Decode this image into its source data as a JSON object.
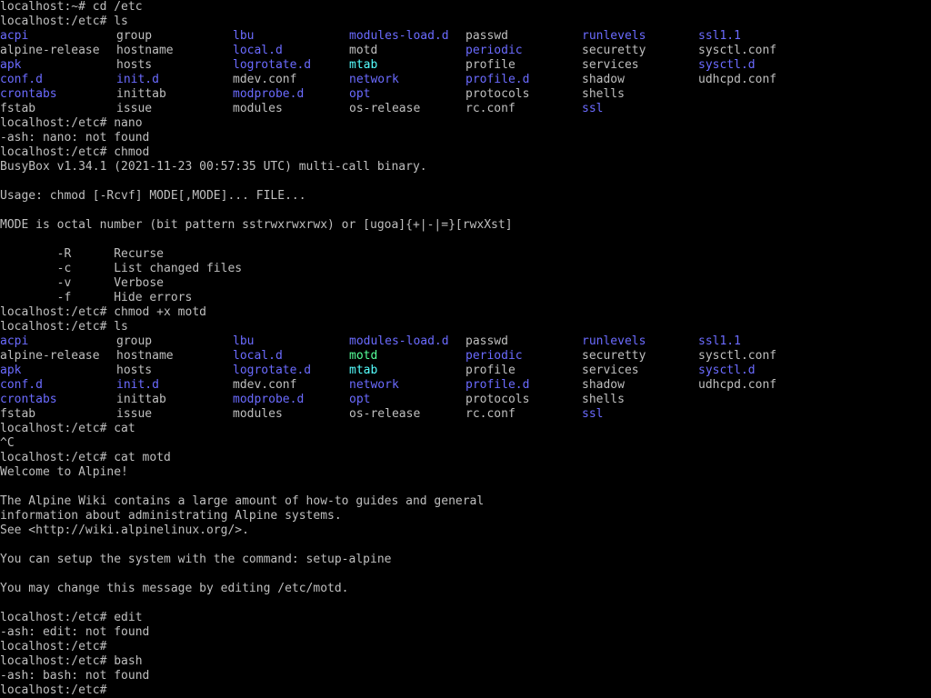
{
  "colors": {
    "background": "#000000",
    "text": "#bfbfbf",
    "directory": "#6b6bff",
    "executable": "#55ff99",
    "symlink": "#55ffff"
  },
  "terminal": {
    "blocks": [
      {
        "type": "text",
        "text": "localhost:~# cd /etc"
      },
      {
        "type": "text",
        "text": "localhost:/etc# ls"
      },
      {
        "type": "ls",
        "rows": [
          [
            {
              "t": "acpi",
              "k": "dir"
            },
            {
              "t": "group",
              "k": "file"
            },
            {
              "t": "lbu",
              "k": "dir"
            },
            {
              "t": "modules-load.d",
              "k": "dir"
            },
            {
              "t": "passwd",
              "k": "file"
            },
            {
              "t": "runlevels",
              "k": "dir"
            },
            {
              "t": "ssl1.1",
              "k": "dir"
            }
          ],
          [
            {
              "t": "alpine-release",
              "k": "file"
            },
            {
              "t": "hostname",
              "k": "file"
            },
            {
              "t": "local.d",
              "k": "dir"
            },
            {
              "t": "motd",
              "k": "file"
            },
            {
              "t": "periodic",
              "k": "dir"
            },
            {
              "t": "securetty",
              "k": "file"
            },
            {
              "t": "sysctl.conf",
              "k": "file"
            }
          ],
          [
            {
              "t": "apk",
              "k": "dir"
            },
            {
              "t": "hosts",
              "k": "file"
            },
            {
              "t": "logrotate.d",
              "k": "dir"
            },
            {
              "t": "mtab",
              "k": "link"
            },
            {
              "t": "profile",
              "k": "file"
            },
            {
              "t": "services",
              "k": "file"
            },
            {
              "t": "sysctl.d",
              "k": "dir"
            }
          ],
          [
            {
              "t": "conf.d",
              "k": "dir"
            },
            {
              "t": "init.d",
              "k": "dir"
            },
            {
              "t": "mdev.conf",
              "k": "file"
            },
            {
              "t": "network",
              "k": "dir"
            },
            {
              "t": "profile.d",
              "k": "dir"
            },
            {
              "t": "shadow",
              "k": "file"
            },
            {
              "t": "udhcpd.conf",
              "k": "file"
            }
          ],
          [
            {
              "t": "crontabs",
              "k": "dir"
            },
            {
              "t": "inittab",
              "k": "file"
            },
            {
              "t": "modprobe.d",
              "k": "dir"
            },
            {
              "t": "opt",
              "k": "dir"
            },
            {
              "t": "protocols",
              "k": "file"
            },
            {
              "t": "shells",
              "k": "file"
            }
          ],
          [
            {
              "t": "fstab",
              "k": "file"
            },
            {
              "t": "issue",
              "k": "file"
            },
            {
              "t": "modules",
              "k": "file"
            },
            {
              "t": "os-release",
              "k": "file"
            },
            {
              "t": "rc.conf",
              "k": "file"
            },
            {
              "t": "ssl",
              "k": "dir"
            }
          ]
        ]
      },
      {
        "type": "text",
        "text": "localhost:/etc# nano"
      },
      {
        "type": "text",
        "text": "-ash: nano: not found"
      },
      {
        "type": "text",
        "text": "localhost:/etc# chmod"
      },
      {
        "type": "text",
        "text": "BusyBox v1.34.1 (2021-11-23 00:57:35 UTC) multi-call binary."
      },
      {
        "type": "text",
        "text": ""
      },
      {
        "type": "text",
        "text": "Usage: chmod [-Rcvf] MODE[,MODE]... FILE..."
      },
      {
        "type": "text",
        "text": ""
      },
      {
        "type": "text",
        "text": "MODE is octal number (bit pattern sstrwxrwxrwx) or [ugoa]{+|-|=}[rwxXst]"
      },
      {
        "type": "text",
        "text": ""
      },
      {
        "type": "text",
        "text": "        -R      Recurse"
      },
      {
        "type": "text",
        "text": "        -c      List changed files"
      },
      {
        "type": "text",
        "text": "        -v      Verbose"
      },
      {
        "type": "text",
        "text": "        -f      Hide errors"
      },
      {
        "type": "text",
        "text": "localhost:/etc# chmod +x motd"
      },
      {
        "type": "text",
        "text": "localhost:/etc# ls"
      },
      {
        "type": "ls",
        "rows": [
          [
            {
              "t": "acpi",
              "k": "dir"
            },
            {
              "t": "group",
              "k": "file"
            },
            {
              "t": "lbu",
              "k": "dir"
            },
            {
              "t": "modules-load.d",
              "k": "dir"
            },
            {
              "t": "passwd",
              "k": "file"
            },
            {
              "t": "runlevels",
              "k": "dir"
            },
            {
              "t": "ssl1.1",
              "k": "dir"
            }
          ],
          [
            {
              "t": "alpine-release",
              "k": "file"
            },
            {
              "t": "hostname",
              "k": "file"
            },
            {
              "t": "local.d",
              "k": "dir"
            },
            {
              "t": "motd",
              "k": "exec"
            },
            {
              "t": "periodic",
              "k": "dir"
            },
            {
              "t": "securetty",
              "k": "file"
            },
            {
              "t": "sysctl.conf",
              "k": "file"
            }
          ],
          [
            {
              "t": "apk",
              "k": "dir"
            },
            {
              "t": "hosts",
              "k": "file"
            },
            {
              "t": "logrotate.d",
              "k": "dir"
            },
            {
              "t": "mtab",
              "k": "link"
            },
            {
              "t": "profile",
              "k": "file"
            },
            {
              "t": "services",
              "k": "file"
            },
            {
              "t": "sysctl.d",
              "k": "dir"
            }
          ],
          [
            {
              "t": "conf.d",
              "k": "dir"
            },
            {
              "t": "init.d",
              "k": "dir"
            },
            {
              "t": "mdev.conf",
              "k": "file"
            },
            {
              "t": "network",
              "k": "dir"
            },
            {
              "t": "profile.d",
              "k": "dir"
            },
            {
              "t": "shadow",
              "k": "file"
            },
            {
              "t": "udhcpd.conf",
              "k": "file"
            }
          ],
          [
            {
              "t": "crontabs",
              "k": "dir"
            },
            {
              "t": "inittab",
              "k": "file"
            },
            {
              "t": "modprobe.d",
              "k": "dir"
            },
            {
              "t": "opt",
              "k": "dir"
            },
            {
              "t": "protocols",
              "k": "file"
            },
            {
              "t": "shells",
              "k": "file"
            }
          ],
          [
            {
              "t": "fstab",
              "k": "file"
            },
            {
              "t": "issue",
              "k": "file"
            },
            {
              "t": "modules",
              "k": "file"
            },
            {
              "t": "os-release",
              "k": "file"
            },
            {
              "t": "rc.conf",
              "k": "file"
            },
            {
              "t": "ssl",
              "k": "dir"
            }
          ]
        ]
      },
      {
        "type": "text",
        "text": "localhost:/etc# cat"
      },
      {
        "type": "text",
        "text": "^C"
      },
      {
        "type": "text",
        "text": "localhost:/etc# cat motd"
      },
      {
        "type": "text",
        "text": "Welcome to Alpine!"
      },
      {
        "type": "text",
        "text": ""
      },
      {
        "type": "text",
        "text": "The Alpine Wiki contains a large amount of how-to guides and general"
      },
      {
        "type": "text",
        "text": "information about administrating Alpine systems."
      },
      {
        "type": "text",
        "text": "See <http://wiki.alpinelinux.org/>."
      },
      {
        "type": "text",
        "text": ""
      },
      {
        "type": "text",
        "text": "You can setup the system with the command: setup-alpine"
      },
      {
        "type": "text",
        "text": ""
      },
      {
        "type": "text",
        "text": "You may change this message by editing /etc/motd."
      },
      {
        "type": "text",
        "text": ""
      },
      {
        "type": "text",
        "text": "localhost:/etc# edit"
      },
      {
        "type": "text",
        "text": "-ash: edit: not found"
      },
      {
        "type": "text",
        "text": "localhost:/etc#"
      },
      {
        "type": "text",
        "text": "localhost:/etc# bash"
      },
      {
        "type": "text",
        "text": "-ash: bash: not found"
      },
      {
        "type": "prompt",
        "text": "localhost:/etc# "
      }
    ]
  }
}
